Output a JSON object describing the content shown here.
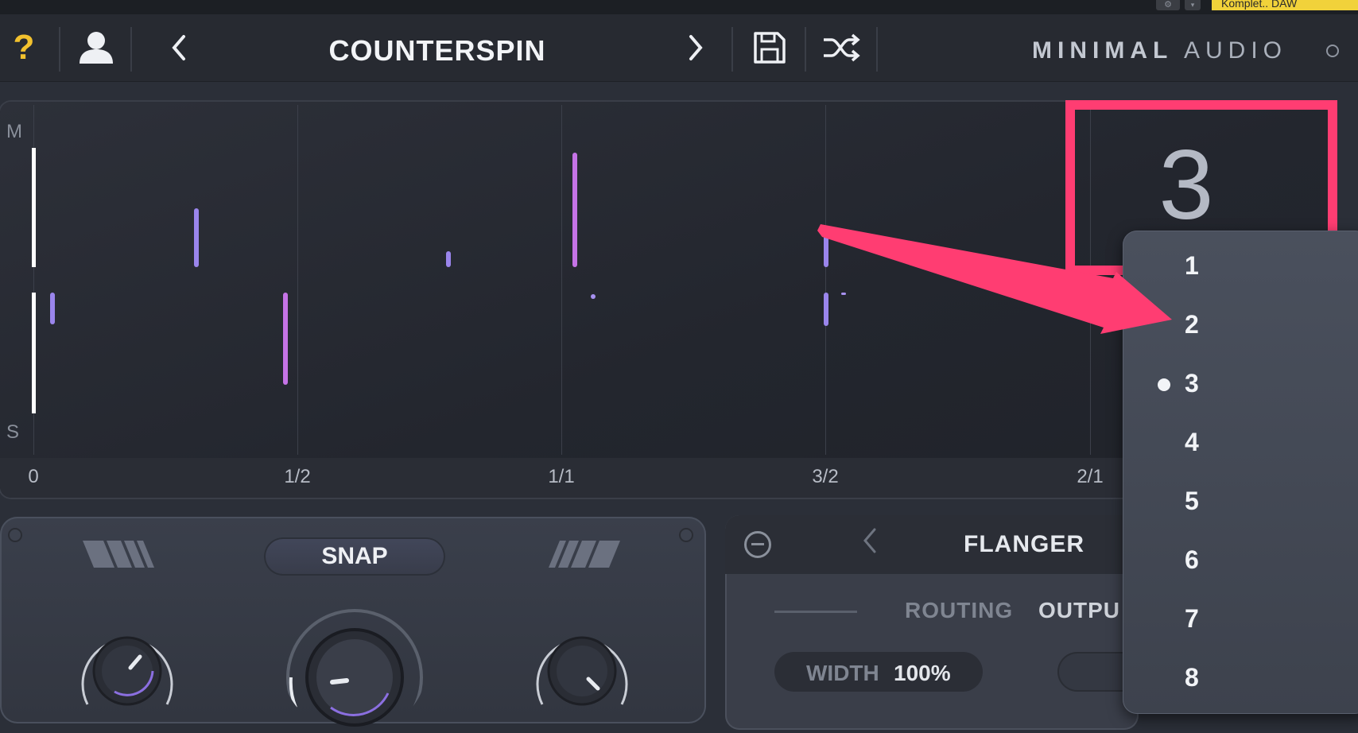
{
  "host": {
    "daw_label": "Komplet.. DAW"
  },
  "header": {
    "help_icon": "question-mark-icon",
    "user_icon": "user-icon",
    "prev_icon": "chevron-left-icon",
    "preset_name": "COUNTERSPIN",
    "next_icon": "chevron-right-icon",
    "save_icon": "save-icon",
    "shuffle_icon": "shuffle-icon",
    "brand_bold": "MINIMAL",
    "brand_light": "AUDIO"
  },
  "display": {
    "top_label": "M",
    "bottom_label": "S",
    "ticks": [
      "0",
      "1/2",
      "1/1",
      "3/2",
      "2/1"
    ],
    "grid_value": "3"
  },
  "dropdown": {
    "options": [
      "1",
      "2",
      "3",
      "4",
      "5",
      "6",
      "7",
      "8"
    ],
    "selected": "3"
  },
  "panel_left": {
    "snap_label": "SNAP"
  },
  "panel_right": {
    "fx_name": "FLANGER",
    "routing_label": "ROUTING",
    "output_label": "OUTPU",
    "width_label": "WIDTH",
    "width_value": "100%"
  },
  "colors": {
    "accent_yellow": "#f2c12e",
    "callout_pink": "#ff3d72",
    "mark_violet": "#9a85ec",
    "mark_pink": "#c573e6"
  }
}
